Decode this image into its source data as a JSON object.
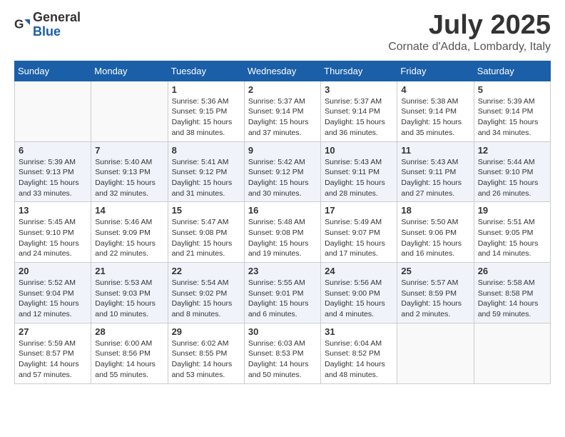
{
  "header": {
    "logo_general": "General",
    "logo_blue": "Blue",
    "month": "July 2025",
    "location": "Cornate d'Adda, Lombardy, Italy"
  },
  "weekdays": [
    "Sunday",
    "Monday",
    "Tuesday",
    "Wednesday",
    "Thursday",
    "Friday",
    "Saturday"
  ],
  "weeks": [
    [
      {
        "day": "",
        "info": ""
      },
      {
        "day": "",
        "info": ""
      },
      {
        "day": "1",
        "info": "Sunrise: 5:36 AM\nSunset: 9:15 PM\nDaylight: 15 hours and 38 minutes."
      },
      {
        "day": "2",
        "info": "Sunrise: 5:37 AM\nSunset: 9:14 PM\nDaylight: 15 hours and 37 minutes."
      },
      {
        "day": "3",
        "info": "Sunrise: 5:37 AM\nSunset: 9:14 PM\nDaylight: 15 hours and 36 minutes."
      },
      {
        "day": "4",
        "info": "Sunrise: 5:38 AM\nSunset: 9:14 PM\nDaylight: 15 hours and 35 minutes."
      },
      {
        "day": "5",
        "info": "Sunrise: 5:39 AM\nSunset: 9:14 PM\nDaylight: 15 hours and 34 minutes."
      }
    ],
    [
      {
        "day": "6",
        "info": "Sunrise: 5:39 AM\nSunset: 9:13 PM\nDaylight: 15 hours and 33 minutes."
      },
      {
        "day": "7",
        "info": "Sunrise: 5:40 AM\nSunset: 9:13 PM\nDaylight: 15 hours and 32 minutes."
      },
      {
        "day": "8",
        "info": "Sunrise: 5:41 AM\nSunset: 9:12 PM\nDaylight: 15 hours and 31 minutes."
      },
      {
        "day": "9",
        "info": "Sunrise: 5:42 AM\nSunset: 9:12 PM\nDaylight: 15 hours and 30 minutes."
      },
      {
        "day": "10",
        "info": "Sunrise: 5:43 AM\nSunset: 9:11 PM\nDaylight: 15 hours and 28 minutes."
      },
      {
        "day": "11",
        "info": "Sunrise: 5:43 AM\nSunset: 9:11 PM\nDaylight: 15 hours and 27 minutes."
      },
      {
        "day": "12",
        "info": "Sunrise: 5:44 AM\nSunset: 9:10 PM\nDaylight: 15 hours and 26 minutes."
      }
    ],
    [
      {
        "day": "13",
        "info": "Sunrise: 5:45 AM\nSunset: 9:10 PM\nDaylight: 15 hours and 24 minutes."
      },
      {
        "day": "14",
        "info": "Sunrise: 5:46 AM\nSunset: 9:09 PM\nDaylight: 15 hours and 22 minutes."
      },
      {
        "day": "15",
        "info": "Sunrise: 5:47 AM\nSunset: 9:08 PM\nDaylight: 15 hours and 21 minutes."
      },
      {
        "day": "16",
        "info": "Sunrise: 5:48 AM\nSunset: 9:08 PM\nDaylight: 15 hours and 19 minutes."
      },
      {
        "day": "17",
        "info": "Sunrise: 5:49 AM\nSunset: 9:07 PM\nDaylight: 15 hours and 17 minutes."
      },
      {
        "day": "18",
        "info": "Sunrise: 5:50 AM\nSunset: 9:06 PM\nDaylight: 15 hours and 16 minutes."
      },
      {
        "day": "19",
        "info": "Sunrise: 5:51 AM\nSunset: 9:05 PM\nDaylight: 15 hours and 14 minutes."
      }
    ],
    [
      {
        "day": "20",
        "info": "Sunrise: 5:52 AM\nSunset: 9:04 PM\nDaylight: 15 hours and 12 minutes."
      },
      {
        "day": "21",
        "info": "Sunrise: 5:53 AM\nSunset: 9:03 PM\nDaylight: 15 hours and 10 minutes."
      },
      {
        "day": "22",
        "info": "Sunrise: 5:54 AM\nSunset: 9:02 PM\nDaylight: 15 hours and 8 minutes."
      },
      {
        "day": "23",
        "info": "Sunrise: 5:55 AM\nSunset: 9:01 PM\nDaylight: 15 hours and 6 minutes."
      },
      {
        "day": "24",
        "info": "Sunrise: 5:56 AM\nSunset: 9:00 PM\nDaylight: 15 hours and 4 minutes."
      },
      {
        "day": "25",
        "info": "Sunrise: 5:57 AM\nSunset: 8:59 PM\nDaylight: 15 hours and 2 minutes."
      },
      {
        "day": "26",
        "info": "Sunrise: 5:58 AM\nSunset: 8:58 PM\nDaylight: 14 hours and 59 minutes."
      }
    ],
    [
      {
        "day": "27",
        "info": "Sunrise: 5:59 AM\nSunset: 8:57 PM\nDaylight: 14 hours and 57 minutes."
      },
      {
        "day": "28",
        "info": "Sunrise: 6:00 AM\nSunset: 8:56 PM\nDaylight: 14 hours and 55 minutes."
      },
      {
        "day": "29",
        "info": "Sunrise: 6:02 AM\nSunset: 8:55 PM\nDaylight: 14 hours and 53 minutes."
      },
      {
        "day": "30",
        "info": "Sunrise: 6:03 AM\nSunset: 8:53 PM\nDaylight: 14 hours and 50 minutes."
      },
      {
        "day": "31",
        "info": "Sunrise: 6:04 AM\nSunset: 8:52 PM\nDaylight: 14 hours and 48 minutes."
      },
      {
        "day": "",
        "info": ""
      },
      {
        "day": "",
        "info": ""
      }
    ]
  ]
}
